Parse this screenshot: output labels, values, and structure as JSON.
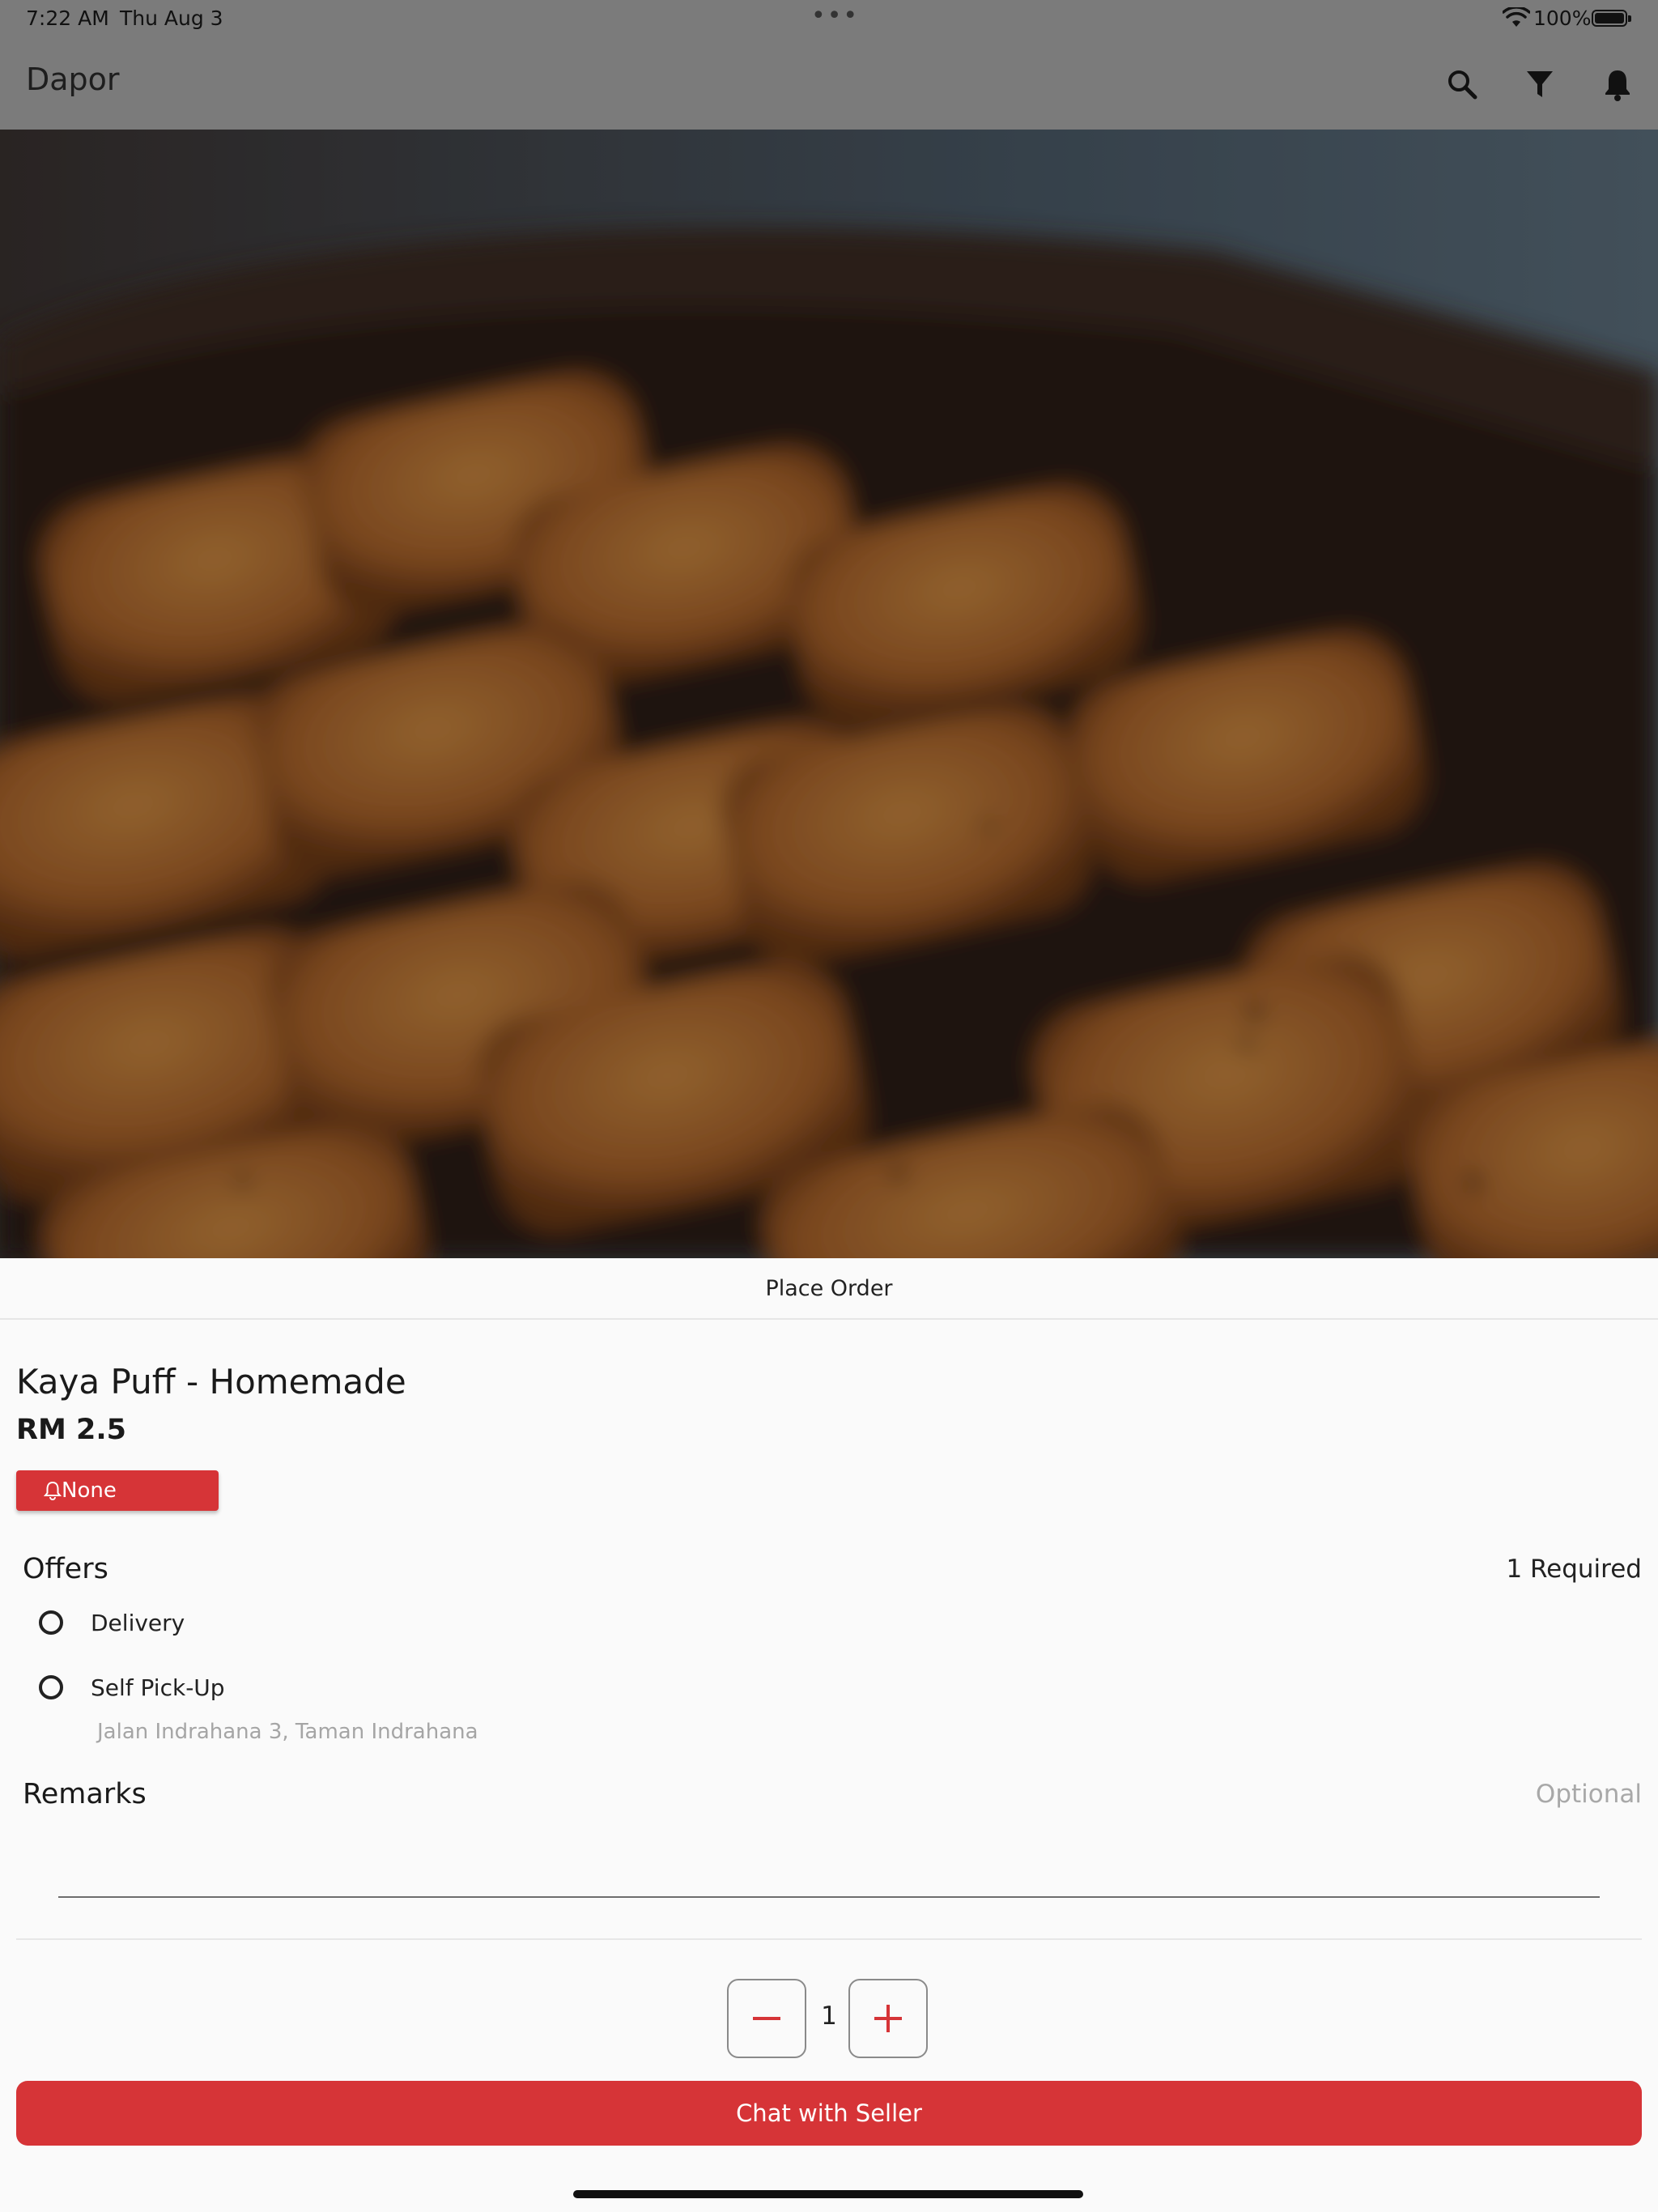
{
  "status_bar": {
    "time": "7:22 AM",
    "date": "Thu Aug 3",
    "dots": "•••",
    "battery": "100%"
  },
  "app_bar": {
    "title": "Dapor",
    "icons": [
      "search-icon",
      "filter-icon",
      "bell-icon"
    ]
  },
  "sheet": {
    "header": "Place Order",
    "product": {
      "name": "Kaya Puff - Homemade",
      "price": "RM 2.5",
      "tag_label": "None"
    },
    "offers": {
      "label": "Offers",
      "hint": "1 Required",
      "options": [
        {
          "label": "Delivery",
          "selected": false
        },
        {
          "label": "Self Pick-Up",
          "selected": false,
          "address": "Jalan Indrahana 3, Taman Indrahana"
        }
      ]
    },
    "remarks": {
      "label": "Remarks",
      "hint": "Optional",
      "value": ""
    },
    "quantity": {
      "value": "1",
      "decrement": "−",
      "increment": "+"
    },
    "chat_button": "Chat with Seller"
  },
  "colors": {
    "accent": "#d63437",
    "dim_overlay": "#7b7b7b",
    "background": "#fafafa"
  }
}
